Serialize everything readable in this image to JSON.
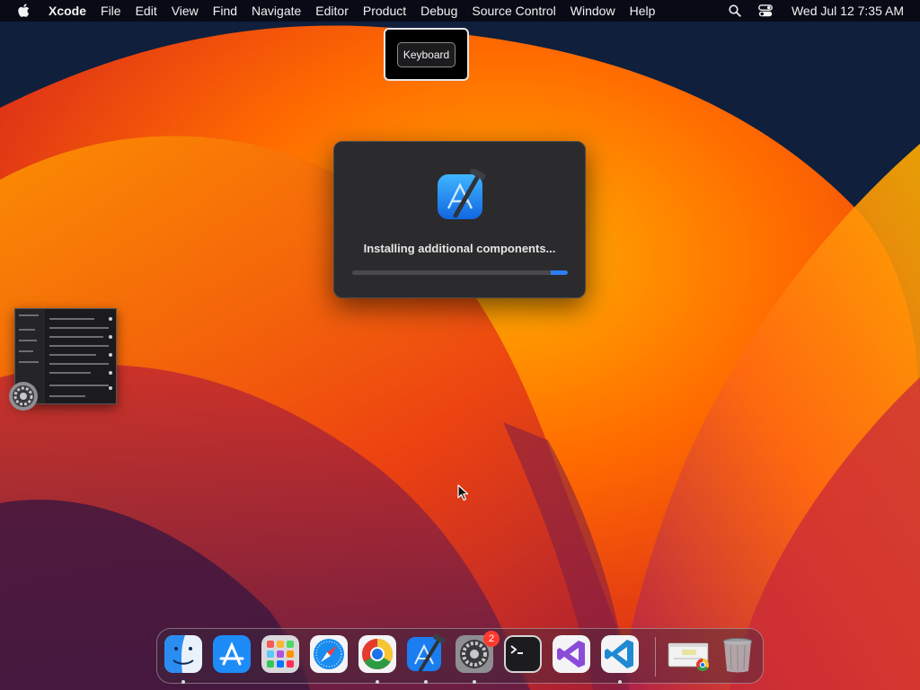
{
  "menubar": {
    "app_name": "Xcode",
    "items": [
      "File",
      "Edit",
      "View",
      "Find",
      "Navigate",
      "Editor",
      "Product",
      "Debug",
      "Source Control",
      "Window",
      "Help"
    ],
    "clock": "Wed Jul 12  7:35 AM"
  },
  "keyboard_hud": {
    "label": "Keyboard"
  },
  "install_dialog": {
    "message": "Installing additional components...",
    "progress": 0.92,
    "accent": "#2f7cf6"
  },
  "dock": {
    "items": [
      {
        "icon": "finder-icon",
        "running": true
      },
      {
        "icon": "app-store-icon",
        "running": false
      },
      {
        "icon": "launchpad-icon",
        "running": false
      },
      {
        "icon": "safari-icon",
        "running": false
      },
      {
        "icon": "chrome-icon",
        "running": true
      },
      {
        "icon": "xcode-icon",
        "running": true
      },
      {
        "icon": "system-settings-icon",
        "running": true,
        "badge": "2"
      },
      {
        "icon": "terminal-icon",
        "running": false
      },
      {
        "icon": "visual-studio-icon",
        "running": false
      },
      {
        "icon": "vscode-icon",
        "running": true
      }
    ],
    "stack_icon": "chrome-window-stack-icon",
    "trash_icon": "trash-icon"
  },
  "colors": {
    "wallpaper_orange": "#ff8a00",
    "wallpaper_red": "#d3201f",
    "wallpaper_navy": "#0f1f3c"
  }
}
